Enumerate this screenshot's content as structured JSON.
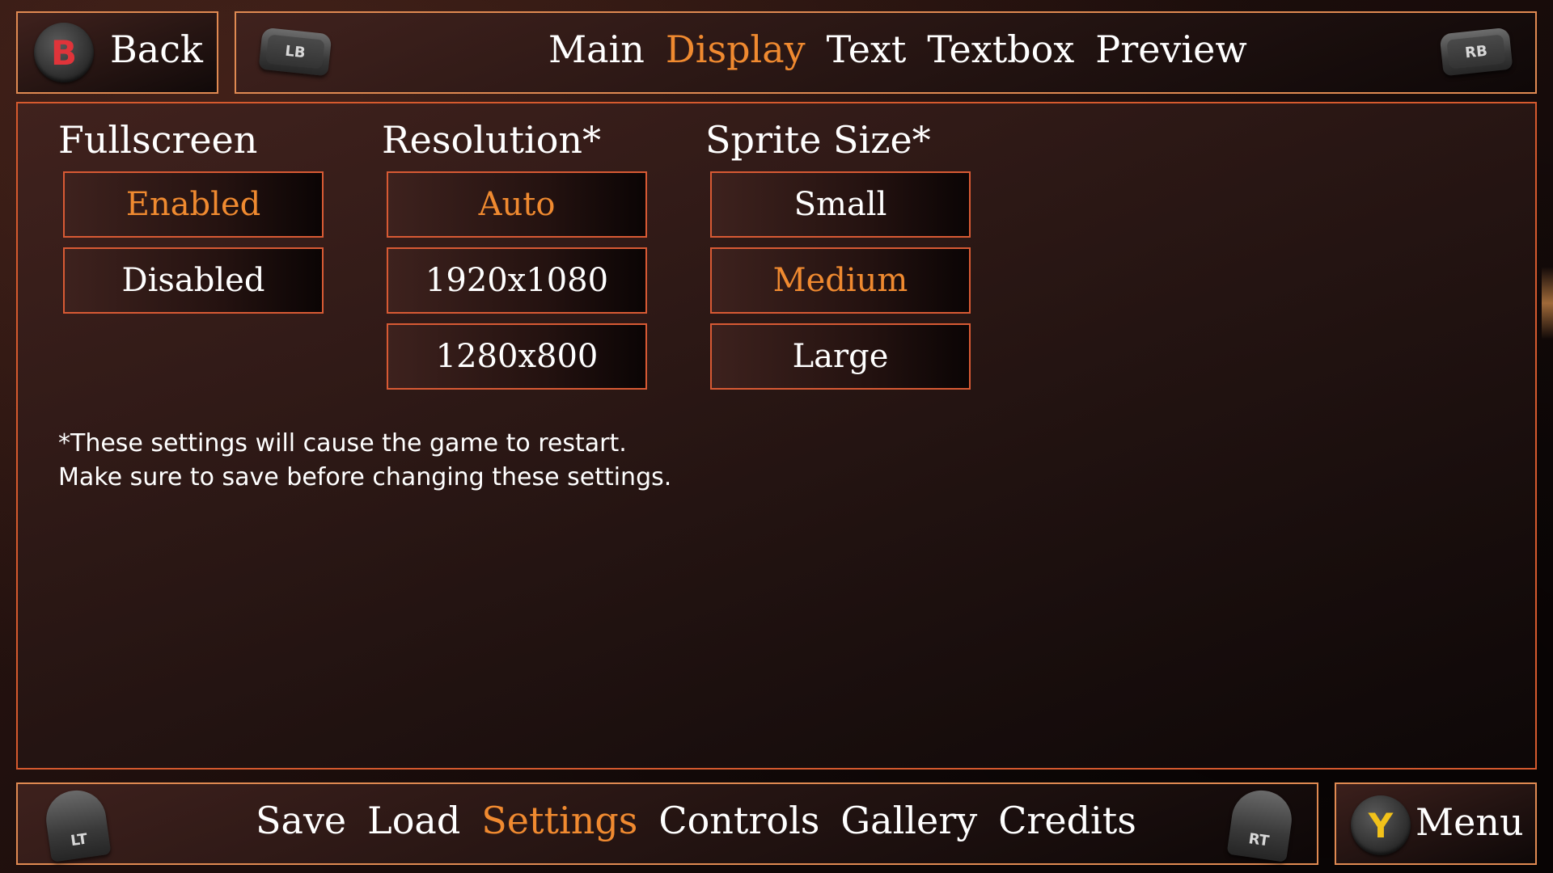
{
  "header": {
    "back_button_glyph": "B",
    "back_label": "Back",
    "left_bumper": "LB",
    "right_bumper": "RB",
    "tabs": [
      {
        "label": "Main",
        "active": false
      },
      {
        "label": "Display",
        "active": true
      },
      {
        "label": "Text",
        "active": false
      },
      {
        "label": "Textbox",
        "active": false
      },
      {
        "label": "Preview",
        "active": false
      }
    ]
  },
  "settings": {
    "fullscreen": {
      "heading": "Fullscreen",
      "options": [
        {
          "label": "Enabled",
          "selected": true
        },
        {
          "label": "Disabled",
          "selected": false
        }
      ]
    },
    "resolution": {
      "heading": "Resolution*",
      "options": [
        {
          "label": "Auto",
          "selected": true
        },
        {
          "label": "1920x1080",
          "selected": false
        },
        {
          "label": "1280x800",
          "selected": false
        }
      ]
    },
    "sprite_size": {
      "heading": "Sprite Size*",
      "options": [
        {
          "label": "Small",
          "selected": false
        },
        {
          "label": "Medium",
          "selected": true
        },
        {
          "label": "Large",
          "selected": false
        }
      ]
    },
    "note_line1": "*These settings will cause the game to restart.",
    "note_line2": "Make sure to save before changing these settings."
  },
  "footer": {
    "left_trigger": "LT",
    "right_trigger": "RT",
    "tabs": [
      {
        "label": "Save",
        "active": false
      },
      {
        "label": "Load",
        "active": false
      },
      {
        "label": "Settings",
        "active": true
      },
      {
        "label": "Controls",
        "active": false
      },
      {
        "label": "Gallery",
        "active": false
      },
      {
        "label": "Credits",
        "active": false
      }
    ],
    "menu_button_glyph": "Y",
    "menu_label": "Menu"
  },
  "colors": {
    "accent_orange": "#f08a30",
    "border_orange": "#d67a3e",
    "b_button_red": "#e0343a",
    "y_button_yellow": "#f2c21a"
  },
  "icons": {
    "b_button": "b-button-icon",
    "y_button": "y-button-icon",
    "lb": "lb-bumper-icon",
    "rb": "rb-bumper-icon",
    "lt": "lt-trigger-icon",
    "rt": "rt-trigger-icon"
  }
}
